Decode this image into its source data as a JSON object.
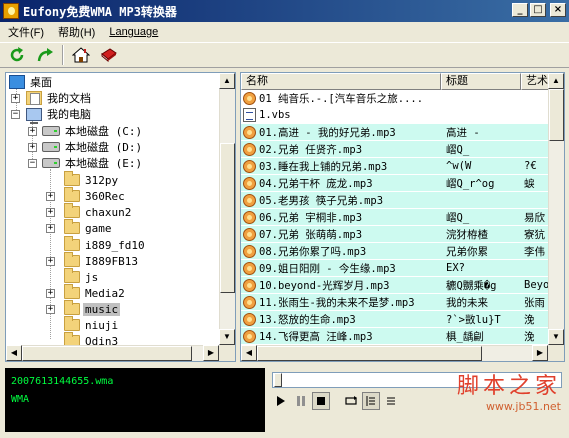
{
  "window": {
    "title": "Eufony免费WMA MP3转换器",
    "minimize": "_",
    "maximize": "□",
    "close": "×"
  },
  "menu": {
    "file": "文件(F)",
    "help": "帮助(H)",
    "language": "Language"
  },
  "toolbar": {
    "refresh_icon": "refresh-icon",
    "forward_icon": "go-forward-icon",
    "home_icon": "home-icon",
    "book_icon": "book-icon"
  },
  "tree": {
    "items": [
      {
        "label": "桌面",
        "icon": "desktop-icon"
      },
      {
        "label": "我的文档",
        "icon": "documents-icon"
      },
      {
        "label": "我的电脑",
        "icon": "computer-icon"
      },
      {
        "label": "本地磁盘 (C:)",
        "icon": "drive-icon"
      },
      {
        "label": "本地磁盘 (D:)",
        "icon": "drive-icon"
      },
      {
        "label": "本地磁盘 (E:)",
        "icon": "drive-icon"
      },
      {
        "label": "312py",
        "icon": "folder-icon"
      },
      {
        "label": "360Rec",
        "icon": "folder-icon"
      },
      {
        "label": "chaxun2",
        "icon": "folder-icon"
      },
      {
        "label": "game",
        "icon": "folder-icon"
      },
      {
        "label": "i889_fd10",
        "icon": "folder-icon"
      },
      {
        "label": "I889FB13",
        "icon": "folder-icon"
      },
      {
        "label": "js",
        "icon": "folder-icon"
      },
      {
        "label": "Media2",
        "icon": "folder-icon"
      },
      {
        "label": "music",
        "icon": "folder-icon"
      },
      {
        "label": "niuji",
        "icon": "folder-icon"
      },
      {
        "label": "Odin3",
        "icon": "folder-icon"
      }
    ],
    "selected": "music"
  },
  "filelist": {
    "columns": [
      "名称",
      "标题",
      "艺术"
    ],
    "rows": [
      {
        "name": "01 纯音乐.-.[汽车音乐之旅....",
        "title": "",
        "artist": "",
        "type": "audio"
      },
      {
        "name": "1.vbs",
        "title": "",
        "artist": "",
        "type": "script"
      },
      {
        "name": "01.高进 - 我的好兄弟.mp3",
        "title": "高进 -",
        "artist": "",
        "type": "mp3"
      },
      {
        "name": "02.兄弟 任贤齐.mp3",
        "title": "嶍Q_",
        "artist": "",
        "type": "mp3"
      },
      {
        "name": "03.睡在我上铺的兄弟.mp3",
        "title": "^w(W",
        "artist": "?€",
        "type": "mp3"
      },
      {
        "name": "04.兄弟干杯 庞龙.mp3",
        "title": "嶍Q_r^og",
        "artist": "蜧",
        "type": "mp3"
      },
      {
        "name": "05.老男孩 筷子兄弟.mp3",
        "title": "",
        "artist": "",
        "type": "mp3"
      },
      {
        "name": "06.兄弟 宇桐非.mp3",
        "title": "嶍Q_",
        "artist": "易欣",
        "type": "mp3"
      },
      {
        "name": "07.兄弟 张萌萌.mp3",
        "title": "浣犲栫楂",
        "artist": "寮犺",
        "type": "mp3"
      },
      {
        "name": "08.兄弟你累了吗.mp3",
        "title": "兄弟你累",
        "artist": "李伟",
        "type": "mp3"
      },
      {
        "name": "09.姐日阳刚 - 今生缘.mp3",
        "title": "EX?",
        "artist": "",
        "type": "mp3"
      },
      {
        "name": "10.beyond-光辉岁月.mp3",
        "title": "穮Q嬲乘�g",
        "artist": "Beyo",
        "type": "mp3"
      },
      {
        "name": "11.张雨生-我的未来不是梦.mp3",
        "title": "我的未来",
        "artist": "张雨",
        "type": "mp3"
      },
      {
        "name": "13.怒放的生命.mp3",
        "title": "?`>敳lu}T",
        "artist": "浼",
        "type": "mp3"
      },
      {
        "name": "14.飞得更高 汪峰.mp3",
        "title": "椇_龋㓲",
        "artist": "浼",
        "type": "mp3"
      }
    ]
  },
  "player": {
    "filename": "2007613144655.wma",
    "format": "WMA",
    "progress": 0
  },
  "watermark": {
    "text": "脚本之家",
    "url": "www.jb51.net"
  }
}
